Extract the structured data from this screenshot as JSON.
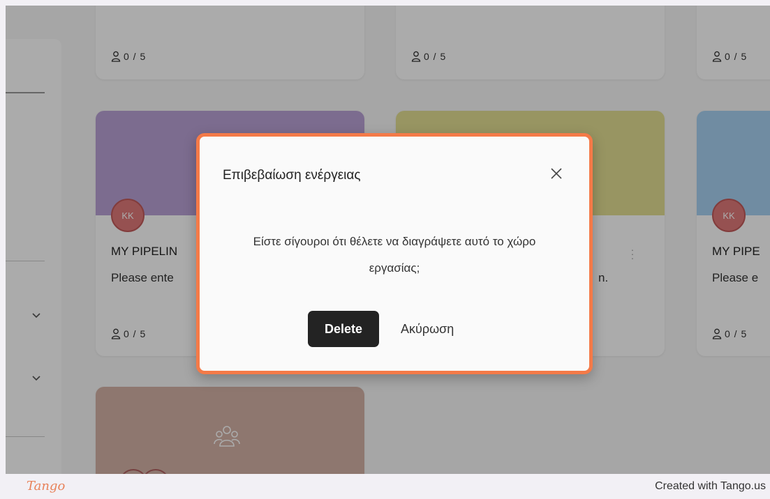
{
  "app": {
    "cards": [
      {
        "members": "0 / 5"
      },
      {
        "members": "0 / 5"
      },
      {
        "members": "0 / 5"
      },
      {
        "avatar": "KK",
        "title": "MY PIPELIN",
        "description": "Please ente",
        "members": "0 / 5",
        "banner_color": "#b9a1d6"
      },
      {
        "description_tail": "n.",
        "banner_color": "#e3df93"
      },
      {
        "avatar": "KK",
        "title": "MY PIPE",
        "description": "Please e",
        "members": "0 / 5",
        "banner_color": "#a8d1f2"
      },
      {
        "banner_color": "#d4b2a6",
        "icon": "group-icon"
      }
    ]
  },
  "modal": {
    "title": "Επιβεβαίωση ενέργειας",
    "message": "Είστε σίγουροι ότι θέλετε να διαγράψετε αυτό το χώρο εργασίας;",
    "confirm_label": "Delete",
    "cancel_label": "Ακύρωση",
    "accent_color": "#f47a48"
  },
  "footer": {
    "logo_text": "Tango",
    "credit": "Created with Tango.us"
  }
}
